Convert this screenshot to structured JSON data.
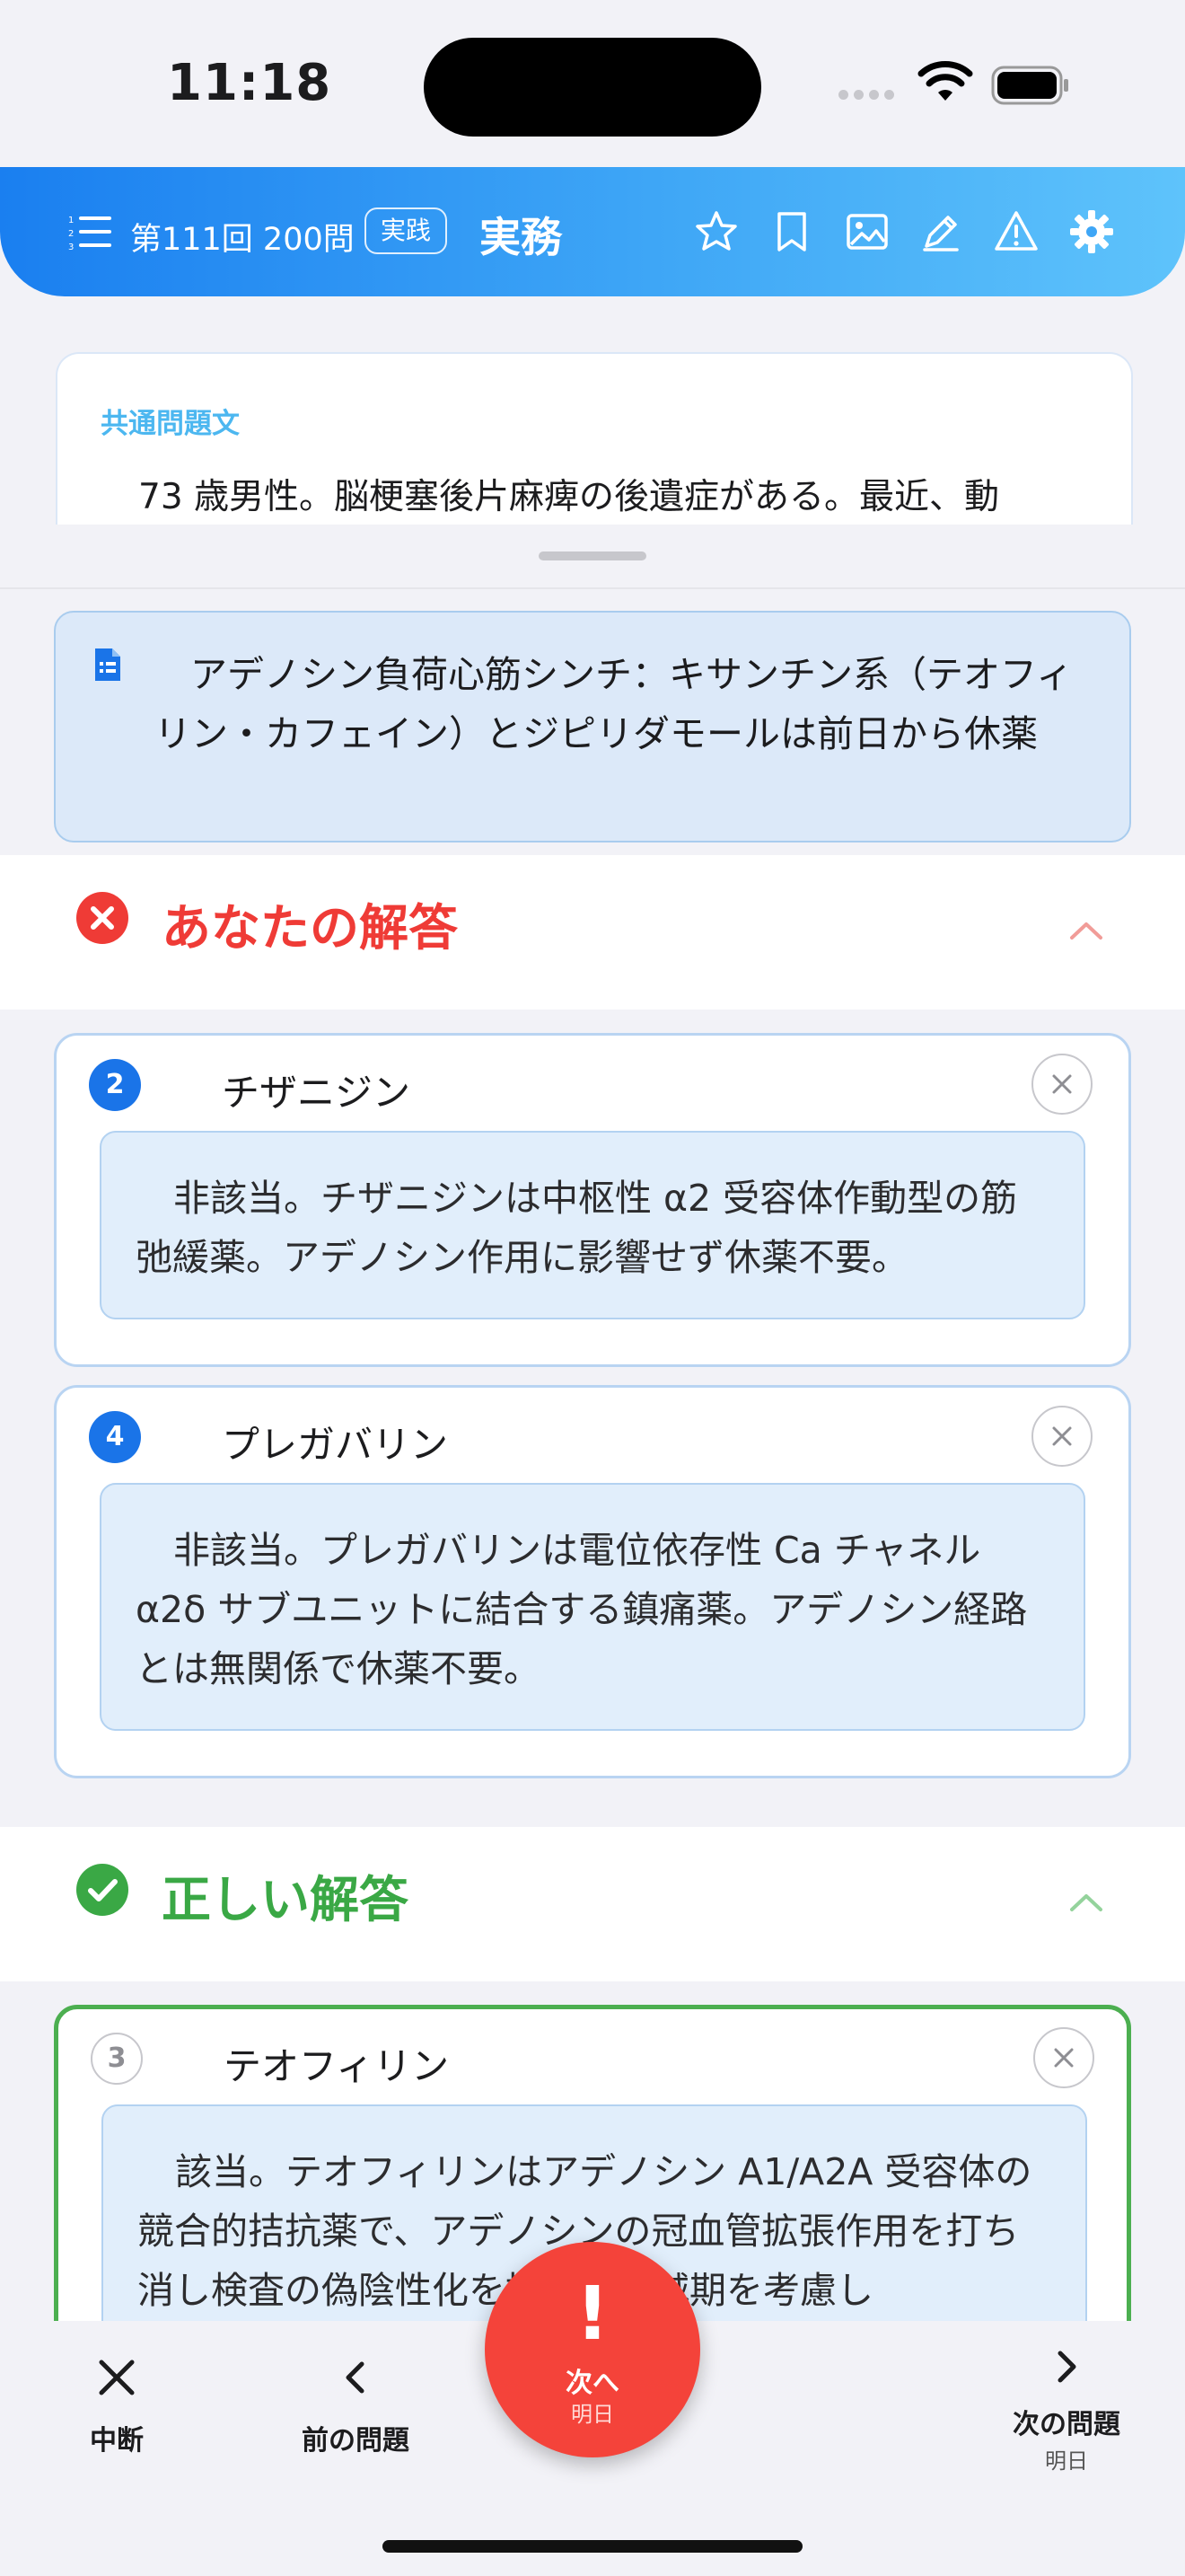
{
  "status_bar": {
    "time": "11:18"
  },
  "header": {
    "exam_label": "第111回 200問",
    "category_badge": "実践",
    "subject": "実務",
    "icons": [
      "list-numbered-icon",
      "star-icon",
      "bookmark-icon",
      "image-icon",
      "pencil-icon",
      "warning-icon",
      "gear-icon"
    ],
    "gradient": [
      "#1a7ff0",
      "#5ec3fb"
    ]
  },
  "common_problem": {
    "label": "共通問題文",
    "text": "73 歳男性。脳梗塞後片麻痺の後遺症がある。最近、動"
  },
  "note": {
    "icon": "document-icon",
    "text": "アデノシン負荷心筋シンチ：キサンチン系（テオフィリン・カフェイン）とジピリダモールは前日から休薬"
  },
  "your_answer": {
    "title": "あなたの解答",
    "color": "#ef3b36",
    "items": [
      {
        "number": "2",
        "name": "チザニジン",
        "explanation": "非該当。チザニジンは中枢性 α2 受容体作動型の筋弛緩薬。アデノシン作用に影響せず休薬不要。"
      },
      {
        "number": "4",
        "name": "プレガバリン",
        "explanation": "非該当。プレガバリンは電位依存性 Ca チャネル α2δ サブユニットに結合する鎮痛薬。アデノシン経路とは無関係で休薬不要。"
      }
    ]
  },
  "correct_answer": {
    "title": "正しい解答",
    "color": "#3aa845",
    "items": [
      {
        "number": "3",
        "name": "テオフィリン",
        "explanation": "該当。テオフィリンはアデノシン A1/A2A 受容体の競合的拮抗薬で、アデノシンの冠血管拡張作用を打ち消し検査の偽陰性化を招く。半減期を考慮し"
      }
    ]
  },
  "toolbar": {
    "abort_label": "中断",
    "prev_label": "前の問題",
    "next_label": "次へ",
    "next_sub": "明日",
    "next_q_label": "次の問題",
    "next_q_sub": "明日",
    "fab_color": "#f4433a"
  }
}
